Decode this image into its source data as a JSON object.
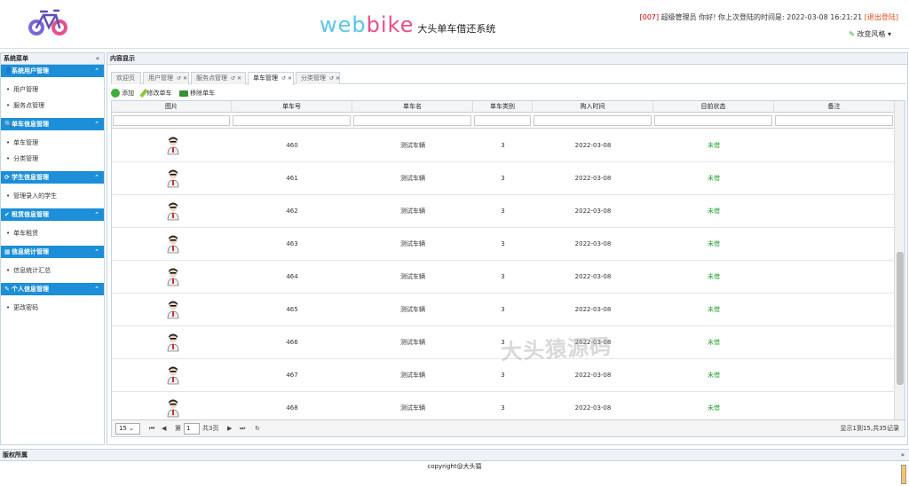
{
  "header": {
    "brand_web": "web",
    "brand_bike": "bike",
    "subtitle": "大头单车借还系统",
    "user_code": "[007]",
    "greeting": "超级管理员 你好! 你上次登陆的时间是:",
    "last_login": "2022-03-08 16:21:21",
    "logout": "[退出登陆]",
    "theme": "改变风格"
  },
  "sidebar": {
    "title": "系统菜单",
    "collapse": "«",
    "groups": [
      {
        "title": "系统用户管理",
        "icon": "user-icon",
        "items": [
          "用户管理",
          "服务点管理"
        ]
      },
      {
        "title": "单车信息管理",
        "icon": "search-icon",
        "items": [
          "单车管理",
          "分类管理"
        ]
      },
      {
        "title": "学生信息管理",
        "icon": "refresh-icon",
        "items": [
          "管理录入的学生"
        ]
      },
      {
        "title": "租赁信息管理",
        "icon": "check-icon",
        "items": [
          "单车租赁"
        ]
      },
      {
        "title": "信息统计管理",
        "icon": "chart-icon",
        "items": [
          "信息统计汇总"
        ]
      },
      {
        "title": "个人信息管理",
        "icon": "pencil-icon",
        "items": [
          "更改密码"
        ]
      }
    ]
  },
  "main": {
    "title": "内容显示",
    "tabs": [
      "欢迎页",
      "用户管理",
      "服务点管理",
      "单车管理",
      "分类管理"
    ],
    "selected_tab": 3,
    "toolbar": [
      "添加",
      "修改单车",
      "移除单车"
    ],
    "columns": [
      "图片",
      "单车号",
      "单车名",
      "单车类别",
      "购入时间",
      "目前状态",
      "备注"
    ],
    "rows": [
      [
        "",
        "460",
        "测试车辆",
        "3",
        "2022-03-08",
        "未借",
        ""
      ],
      [
        "",
        "461",
        "测试车辆",
        "3",
        "2022-03-08",
        "未借",
        ""
      ],
      [
        "",
        "462",
        "测试车辆",
        "3",
        "2022-03-08",
        "未借",
        ""
      ],
      [
        "",
        "463",
        "测试车辆",
        "3",
        "2022-03-08",
        "未借",
        ""
      ],
      [
        "",
        "464",
        "测试车辆",
        "3",
        "2022-03-08",
        "未借",
        ""
      ],
      [
        "",
        "465",
        "测试车辆",
        "3",
        "2022-03-08",
        "未借",
        ""
      ],
      [
        "",
        "466",
        "测试车辆",
        "3",
        "2022-03-08",
        "未借",
        ""
      ],
      [
        "",
        "467",
        "测试车辆",
        "3",
        "2022-03-08",
        "未借",
        ""
      ],
      [
        "",
        "468",
        "测试车辆",
        "3",
        "2022-03-08",
        "未借",
        ""
      ]
    ],
    "pager": {
      "page_size": "15",
      "page_label": "第",
      "page": "1",
      "total_pages": "共3页",
      "info": "显示1到15,共35记录"
    },
    "watermark": "大头猿源码"
  },
  "footer": {
    "title": "版权所属",
    "collapse": "»",
    "copyright": "copyright@大头猿"
  },
  "colors": {
    "accent": "#1c8fd8",
    "status_green": "#22a02a",
    "logout_red": "#e04a1a"
  }
}
